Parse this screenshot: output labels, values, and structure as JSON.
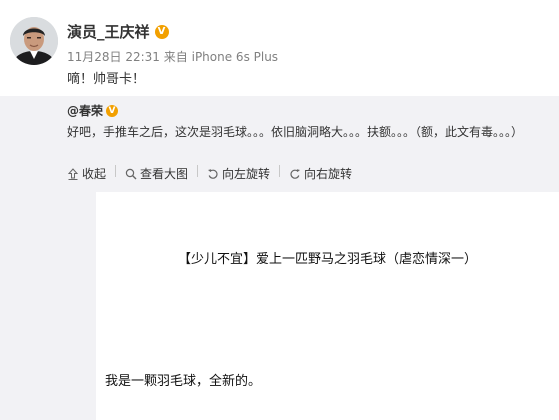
{
  "post": {
    "author": "演员_王庆祥",
    "time": "11月28日 22:31",
    "from_label": "来自",
    "source": "iPhone 6s Plus",
    "text": "嘀！帅哥卡！"
  },
  "repost": {
    "author": "@春荣",
    "text": "好吧，手推车之后，这次是羽毛球。。。依旧脑洞略大。。。扶额。。。（额，此文有毒。。。）",
    "actions": [
      {
        "label": "收起",
        "icon": "collapse-icon"
      },
      {
        "label": "查看大图",
        "icon": "magnify-icon"
      },
      {
        "label": "向左旋转",
        "icon": "rotate-left-icon"
      },
      {
        "label": "向右旋转",
        "icon": "rotate-right-icon"
      }
    ]
  },
  "image": {
    "title": "【少儿不宜】爱上一匹野马之羽毛球（虐恋情深一）",
    "line1": "我是一颗羽毛球，全新的。"
  },
  "colors": {
    "badge": "#f2a000",
    "repost_bg": "#f2f2f5",
    "meta": "#808080"
  }
}
